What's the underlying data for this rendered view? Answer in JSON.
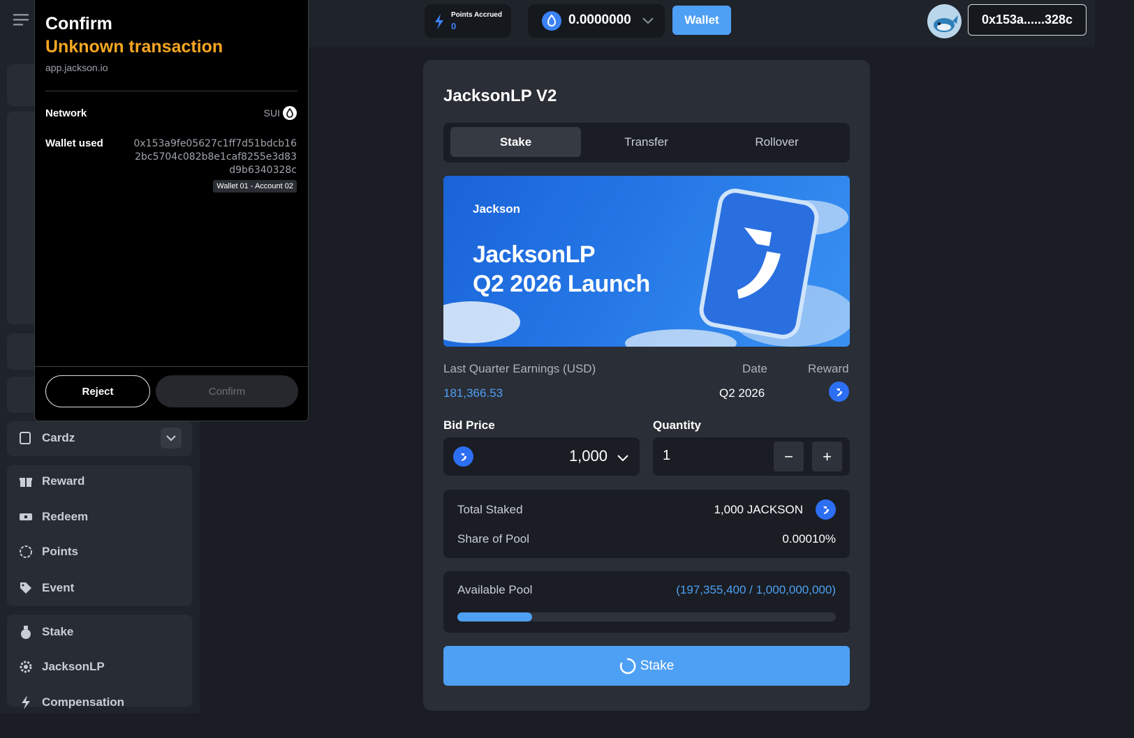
{
  "topbar": {
    "points_label": "Points Accrued",
    "points_value": "0",
    "balance": "0.0000000",
    "wallet_label": "Wallet",
    "address": "0x153a......328c"
  },
  "sidebar": {
    "cardz_label": "Cardz",
    "group1": [
      "Reward",
      "Redeem",
      "Points",
      "Event"
    ],
    "group2": [
      "Stake",
      "JacksonLP",
      "Compensation"
    ]
  },
  "main": {
    "title": "JacksonLP V2",
    "tabs": [
      "Stake",
      "Transfer",
      "Rollover"
    ],
    "active_tab": "Stake",
    "banner": {
      "brand": "Jackson",
      "headline_1": "JacksonLP",
      "headline_2": "Q2 2026 Launch"
    },
    "earnings_label": "Last Quarter Earnings (USD)",
    "earnings_value": "181,366.53",
    "date_label": "Date",
    "date_value": "Q2 2026",
    "reward_label": "Reward",
    "bid_price_label": "Bid Price",
    "bid_price_value": "1,000",
    "quantity_label": "Quantity",
    "quantity_value": "1",
    "minus": "−",
    "plus": "+",
    "total_staked_label": "Total Staked",
    "total_staked_value": "1,000 JACKSON",
    "share_label": "Share of Pool",
    "share_value": "0.00010%",
    "available_label": "Available Pool",
    "available_value": "(197,355,400 / 1,000,000,000)",
    "available_fraction": 0.197,
    "stake_button": "Stake"
  },
  "dialog": {
    "title": "Confirm",
    "subtitle": "Unknown transaction",
    "origin": "app.jackson.io",
    "network_label": "Network",
    "network_value": "SUI",
    "wallet_label": "Wallet used",
    "wallet_address": "0x153a9fe05627c1ff7d51bdcb162bc5704c082b8e1caf8255e3d83d9b6340328c",
    "wallet_tag": "Wallet 01 - Account 02",
    "reject": "Reject",
    "confirm": "Confirm"
  },
  "colors": {
    "accent": "#4ea0f5",
    "warning": "#f6a623",
    "background": "#1a1d23",
    "card": "#2a2e36"
  },
  "icons": [
    "menu-icon",
    "bolt-icon",
    "sui-drop-icon",
    "chevron-down-icon",
    "avatar-whale",
    "gift-icon",
    "ticket-icon",
    "points-icon",
    "tag-icon",
    "moneybag-icon",
    "gear-icon",
    "jackson-coin-icon",
    "spinner-icon"
  ]
}
